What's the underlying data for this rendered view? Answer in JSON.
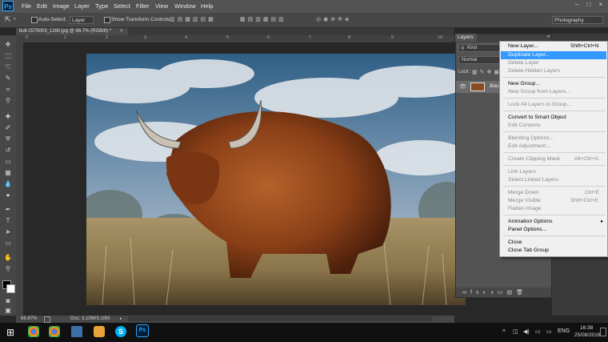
{
  "app": {
    "logo_text": "Ps"
  },
  "menubar": {
    "items": [
      "File",
      "Edit",
      "Image",
      "Layer",
      "Type",
      "Select",
      "Filter",
      "View",
      "Window",
      "Help"
    ],
    "window_controls": [
      "–",
      "□",
      "×"
    ]
  },
  "options_bar": {
    "auto_select_label": "Auto-Select:",
    "auto_select_value": "Layer",
    "show_transform_label": "Show Transform Controls",
    "workspace": "Photography"
  },
  "document": {
    "tab_title": "bull-1575003_1280.jpg @ 66.7% (RGB/8) *",
    "tab_close": "×",
    "ruler_ticks": [
      "0",
      "1",
      "2",
      "3",
      "4",
      "5",
      "6",
      "7",
      "8",
      "9",
      "10"
    ]
  },
  "status": {
    "zoom": "66.67%",
    "doc_info": "Doc: 3.10M/3.10M"
  },
  "layers_panel": {
    "title": "Layers",
    "kind_label": "Kind",
    "blend_mode": "Normal",
    "lock_label": "Lock:",
    "layer_name": "Back",
    "collapse_glyph": "»"
  },
  "context_menu": {
    "items": [
      {
        "label": "New Layer...",
        "shortcut": "Shift+Ctrl+N",
        "enabled": true
      },
      {
        "label": "Duplicate Layer...",
        "shortcut": "",
        "enabled": true,
        "highlighted": true
      },
      {
        "label": "Delete Layer",
        "shortcut": "",
        "enabled": false
      },
      {
        "label": "Delete Hidden Layers",
        "shortcut": "",
        "enabled": false
      },
      {
        "label": "New Group...",
        "shortcut": "",
        "enabled": true
      },
      {
        "label": "New Group from Layers...",
        "shortcut": "",
        "enabled": false
      },
      {
        "label": "Lock All Layers in Group...",
        "shortcut": "",
        "enabled": false
      },
      {
        "label": "Convert to Smart Object",
        "shortcut": "",
        "enabled": true
      },
      {
        "label": "Edit Contents",
        "shortcut": "",
        "enabled": false
      },
      {
        "label": "Blending Options...",
        "shortcut": "",
        "enabled": false
      },
      {
        "label": "Edit Adjustment...",
        "shortcut": "",
        "enabled": false
      },
      {
        "label": "Create Clipping Mask",
        "shortcut": "Alt+Ctrl+G",
        "enabled": false
      },
      {
        "label": "Link Layers",
        "shortcut": "",
        "enabled": false
      },
      {
        "label": "Select Linked Layers",
        "shortcut": "",
        "enabled": false
      },
      {
        "label": "Merge Down",
        "shortcut": "Ctrl+E",
        "enabled": false
      },
      {
        "label": "Merge Visible",
        "shortcut": "Shift+Ctrl+E",
        "enabled": false
      },
      {
        "label": "Flatten Image",
        "shortcut": "",
        "enabled": false
      },
      {
        "label": "Animation Options",
        "shortcut": "",
        "enabled": true,
        "submenu": true
      },
      {
        "label": "Panel Options...",
        "shortcut": "",
        "enabled": true
      },
      {
        "label": "Close",
        "shortcut": "",
        "enabled": true
      },
      {
        "label": "Close Tab Group",
        "shortcut": "",
        "enabled": true
      }
    ],
    "submenu_arrow": "▸"
  },
  "taskbar": {
    "language": "ENG",
    "time": "16:38",
    "date": "25/08/2016"
  },
  "colors": {
    "highlight": "#3399ff",
    "ps_blue": "#31a8ff"
  }
}
